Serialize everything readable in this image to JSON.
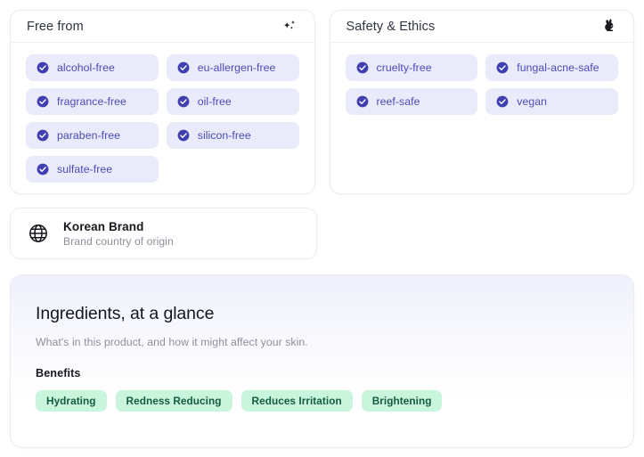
{
  "cards": {
    "free_from": {
      "title": "Free from",
      "icon": "sparkles-icon",
      "chips": [
        {
          "label": "alcohol-free"
        },
        {
          "label": "eu-allergen-free"
        },
        {
          "label": "fragrance-free"
        },
        {
          "label": "oil-free"
        },
        {
          "label": "paraben-free"
        },
        {
          "label": "silicon-free"
        },
        {
          "label": "sulfate-free"
        }
      ]
    },
    "safety_ethics": {
      "title": "Safety & Ethics",
      "icon": "rabbit-icon",
      "chips": [
        {
          "label": "cruelty-free"
        },
        {
          "label": "fungal-acne-safe"
        },
        {
          "label": "reef-safe"
        },
        {
          "label": "vegan"
        }
      ]
    },
    "origin": {
      "icon": "globe-icon",
      "title": "Korean Brand",
      "subtitle": "Brand country of origin"
    }
  },
  "ingredients": {
    "title": "Ingredients, at a glance",
    "subtitle": "What's in this product, and how it might affect your skin.",
    "benefits_label": "Benefits",
    "benefits": [
      {
        "label": "Hydrating"
      },
      {
        "label": "Redness Reducing"
      },
      {
        "label": "Reduces Irritation"
      },
      {
        "label": "Brightening"
      }
    ]
  },
  "colors": {
    "chip_bg": "#e9ebfa",
    "chip_text": "#4a4ab8",
    "check_fill": "#3f3fb0",
    "benefit_bg": "#c8f5db",
    "benefit_text": "#155d3c",
    "card_border": "#ececf1",
    "panel_gradient_top": "#eef0fb"
  }
}
